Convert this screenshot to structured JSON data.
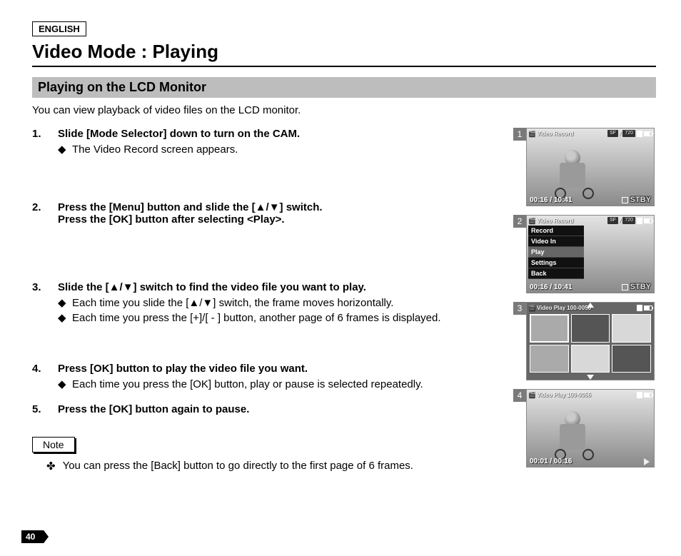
{
  "lang": "ENGLISH",
  "title": "Video Mode : Playing",
  "subtitle": "Playing on the LCD Monitor",
  "intro": "You can view playback of video files on the LCD monitor.",
  "steps": {
    "s1": {
      "num": "1.",
      "head": "Slide [Mode Selector] down to turn on the CAM.",
      "b1": "The Video Record screen appears."
    },
    "s2": {
      "num": "2.",
      "head_l1": "Press the [Menu] button and slide the [▲/▼] switch.",
      "head_l2": "Press the [OK] button after selecting <Play>."
    },
    "s3": {
      "num": "3.",
      "head": "Slide the [▲/▼] switch to find the video file you want to play.",
      "b1": "Each time you slide the [▲/▼] switch, the frame moves horizontally.",
      "b2": "Each time you press the [+]/[ - ] button, another page of 6 frames is displayed."
    },
    "s4": {
      "num": "4.",
      "head": "Press [OK] button to play the video file you want.",
      "b1": "Each time you press the [OK] button, play or pause is selected repeatedly."
    },
    "s5": {
      "num": "5.",
      "head": "Press the [OK] button again to pause."
    }
  },
  "note_label": "Note",
  "note_text": "You can press the [Back] button to go directly to the first page of 6 frames.",
  "page_number": "40",
  "diamond": "◆",
  "cross": "✤",
  "screens": {
    "rec_title": "Video Record",
    "play_title": "Video Play",
    "sf": "SF",
    "sep": "/",
    "res": "720",
    "time_rec": "00:16 / 10:41",
    "time_play": "00:01 / 00:16",
    "stby": "STBY",
    "folder": "100-0056",
    "menu": {
      "record": "Record",
      "video_in": "Video In",
      "play": "Play",
      "settings": "Settings",
      "back": "Back"
    }
  },
  "shot_nums": {
    "n1": "1",
    "n2": "2",
    "n3": "3",
    "n4": "4"
  }
}
